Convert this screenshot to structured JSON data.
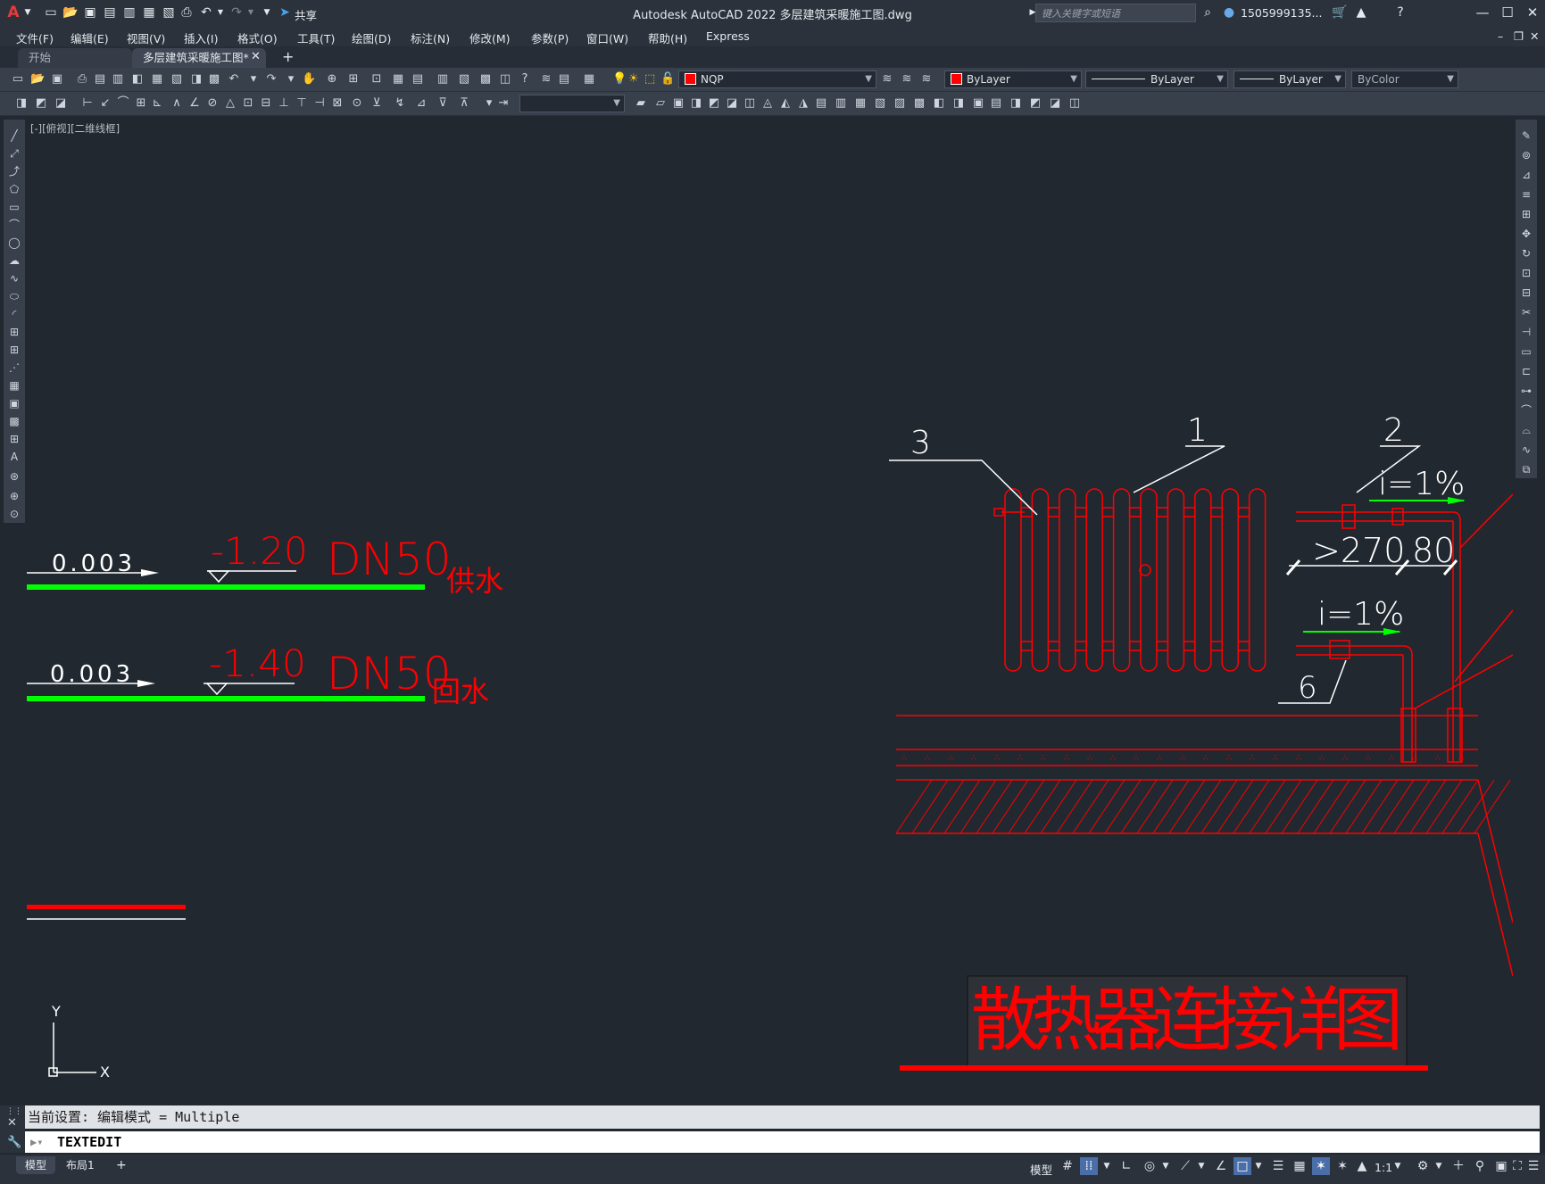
{
  "app": {
    "title": "Autodesk AutoCAD 2022    多层建筑采暖施工图.dwg",
    "share_label": "共享",
    "search_placeholder": "键入关键字或短语",
    "user": "1505999135...",
    "logo": "A"
  },
  "menu": [
    "文件(F)",
    "编辑(E)",
    "视图(V)",
    "插入(I)",
    "格式(O)",
    "工具(T)",
    "绘图(D)",
    "标注(N)",
    "修改(M)",
    "参数(P)",
    "窗口(W)",
    "帮助(H)",
    "Express"
  ],
  "tabs": {
    "start": "开始",
    "drawing": "多层建筑采暖施工图*",
    "close": "✕",
    "add": "+"
  },
  "layer_toolbar": {
    "layer": "NQP",
    "color": "ByLayer",
    "linetype": "ByLayer",
    "lineweight": "ByLayer",
    "plotstyle": "ByColor",
    "layer_color": "#ff0000"
  },
  "viewport_label": "[-][俯视][二维线框]",
  "drawing": {
    "supply": {
      "slope": "0.003",
      "elevation": "-1.20",
      "size": "DN50",
      "label": "供水"
    },
    "return": {
      "slope": "0.003",
      "elevation": "-1.40",
      "size": "DN50",
      "label": "回水"
    },
    "callouts": [
      "3",
      "1",
      "2",
      "6"
    ],
    "slope_top": "i=1%",
    "slope_bottom": "i=1%",
    "dim_1": ">270",
    "dim_2": "80",
    "detail_title": "散热器连接详图",
    "ucs_x": "X",
    "ucs_y": "Y",
    "colors": {
      "red": "#ff0000",
      "green": "#00ff00",
      "white": "#ffffff"
    }
  },
  "command": {
    "history": "当前设置: 编辑模式 = Multiple",
    "input": "TEXTEDIT"
  },
  "status": {
    "layout_tabs": [
      "模型",
      "布局1"
    ],
    "add": "+",
    "model_label": "模型",
    "scale": "1:1"
  }
}
